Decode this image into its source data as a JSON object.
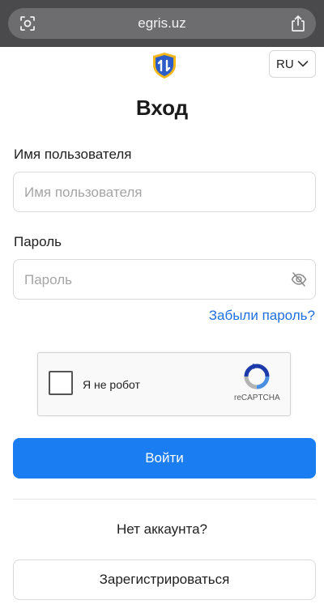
{
  "browser": {
    "url": "egris.uz",
    "left_icon": "visual-lookup-icon",
    "right_icon": "share-icon"
  },
  "header": {
    "logo_icon": "shield-logo-icon",
    "language": "RU",
    "language_icon": "chevron-down-icon"
  },
  "form": {
    "title": "Вход",
    "username_label": "Имя пользователя",
    "username_placeholder": "Имя пользователя",
    "password_label": "Пароль",
    "password_placeholder": "Пароль",
    "password_toggle_icon": "eye-off-icon",
    "forgot_link": "Забыли пароль?",
    "captcha_label": "Я не робот",
    "captcha_brand": "reCAPTCHA",
    "login_button": "Войти",
    "no_account_text": "Нет аккаунта?",
    "register_button": "Зарегистрироваться"
  },
  "colors": {
    "primary": "#1a7df2",
    "link": "#1f6fe0",
    "browser_bar": "#4a4a4c"
  }
}
